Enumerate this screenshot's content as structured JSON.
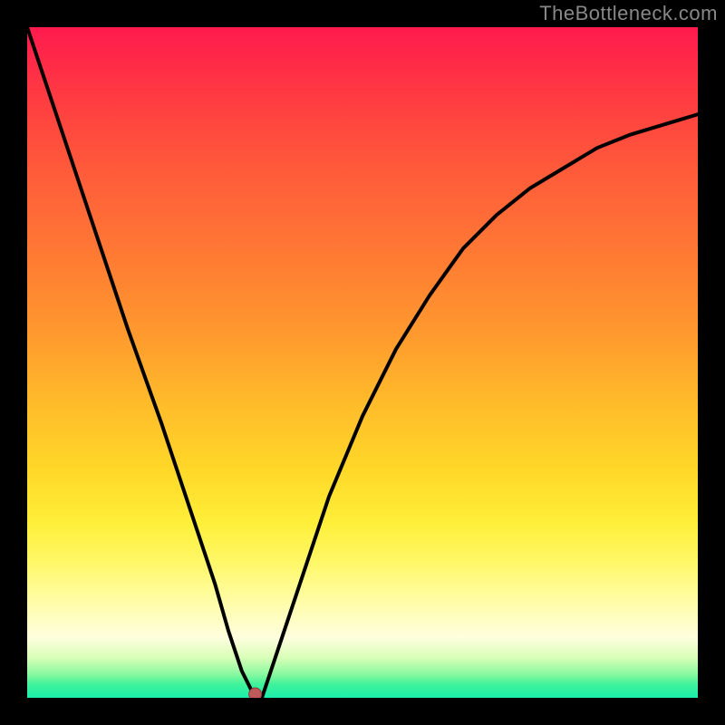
{
  "watermark": "TheBottleneck.com",
  "chart_data": {
    "type": "line",
    "title": "",
    "xlabel": "",
    "ylabel": "",
    "x": [
      0.0,
      0.05,
      0.1,
      0.15,
      0.2,
      0.25,
      0.28,
      0.3,
      0.32,
      0.34,
      0.35,
      0.4,
      0.45,
      0.5,
      0.55,
      0.6,
      0.65,
      0.7,
      0.75,
      0.8,
      0.85,
      0.9,
      0.95,
      1.0
    ],
    "values": [
      100,
      85,
      70,
      55,
      41,
      26,
      17,
      10,
      4,
      0,
      0,
      15,
      30,
      42,
      52,
      60,
      67,
      72,
      76,
      79,
      82,
      84,
      85.5,
      87
    ],
    "xlim": [
      0,
      1
    ],
    "ylim": [
      0,
      100
    ],
    "minimum": {
      "x": 0.34,
      "y": 0
    },
    "color_scale": {
      "bottom": "#1aeeab",
      "mid": "#ffd828",
      "top": "#ff1a4d"
    },
    "description": "V-shaped bottleneck curve on a red-to-green vertical gradient; minimum near x≈0.34 lands in the green band."
  }
}
